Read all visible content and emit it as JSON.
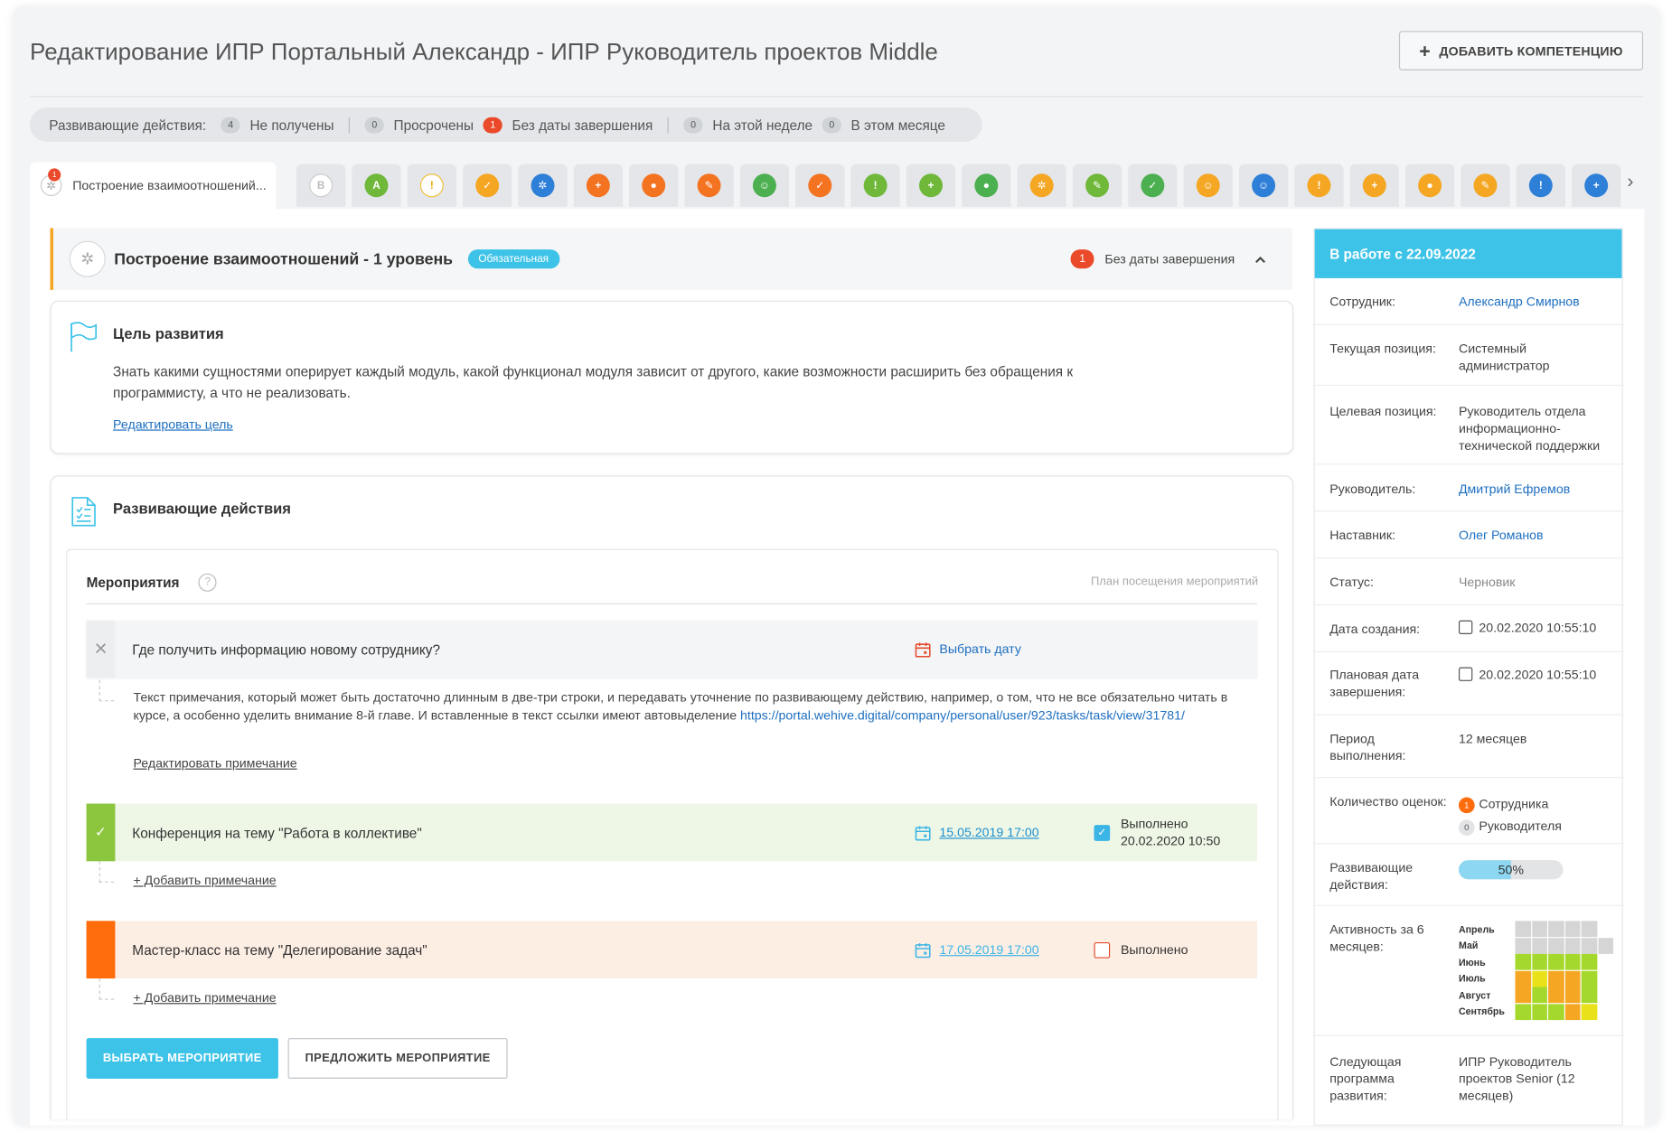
{
  "page": {
    "title": "Редактирование ИПР Портальный Александр - ИПР Руководитель проектов Middle",
    "add_button": "ДОБАВИТЬ КОМПЕТЕНЦИЮ"
  },
  "filters": {
    "label": "Развивающие действия:",
    "items": [
      {
        "count": "4",
        "label": "Не получены",
        "highlight": false
      },
      {
        "count": "0",
        "label": "Просрочены",
        "highlight": false
      },
      {
        "count": "1",
        "label": "Без даты завершения",
        "highlight": true
      },
      {
        "count": "0",
        "label": "На этой неделе",
        "highlight": false
      },
      {
        "count": "0",
        "label": "В этом месяце",
        "highlight": false
      }
    ]
  },
  "tabs": {
    "active": {
      "label": "Построение взаимоотношений...",
      "badge": "1"
    },
    "icons": [
      {
        "name": "b-icon",
        "glyph": "B",
        "color": "#ffffff",
        "fg": "#bbbbbb",
        "border": "#cccccc"
      },
      {
        "name": "a-icon",
        "glyph": "A",
        "color": "#6fb83a",
        "fg": "#ffffff",
        "border": ""
      },
      {
        "name": "medal-icon",
        "glyph": "!",
        "color": "#ffffff",
        "fg": "#f0a500",
        "border": "#f0c040"
      },
      {
        "name": "checkbox-icon",
        "glyph": "✓",
        "color": "#f5a623",
        "fg": "#ffffff",
        "border": ""
      },
      {
        "name": "gear-icon",
        "glyph": "✲",
        "color": "#2d7fd8",
        "fg": "#ffffff",
        "border": ""
      },
      {
        "name": "plus-doc-icon",
        "glyph": "+",
        "color": "#f47321",
        "fg": "#ffffff",
        "border": ""
      },
      {
        "name": "coin-icon",
        "glyph": "●",
        "color": "#f47321",
        "fg": "#ffffff",
        "border": ""
      },
      {
        "name": "pencil-icon",
        "glyph": "✎",
        "color": "#f47321",
        "fg": "#ffffff",
        "border": ""
      },
      {
        "name": "person-icon",
        "glyph": "☺",
        "color": "#4cb050",
        "fg": "#ffffff",
        "border": ""
      },
      {
        "name": "checkbox-icon",
        "glyph": "✓",
        "color": "#f47321",
        "fg": "#ffffff",
        "border": ""
      },
      {
        "name": "medal-icon",
        "glyph": "!",
        "color": "#6fb83a",
        "fg": "#ffffff",
        "border": ""
      },
      {
        "name": "plus-doc-icon",
        "glyph": "+",
        "color": "#6fb83a",
        "fg": "#ffffff",
        "border": ""
      },
      {
        "name": "coin-icon",
        "glyph": "●",
        "color": "#4cb050",
        "fg": "#ffffff",
        "border": ""
      },
      {
        "name": "gear-icon",
        "glyph": "✲",
        "color": "#f5a623",
        "fg": "#ffffff",
        "border": ""
      },
      {
        "name": "pencil-icon",
        "glyph": "✎",
        "color": "#6fb83a",
        "fg": "#ffffff",
        "border": ""
      },
      {
        "name": "checkbox-icon",
        "glyph": "✓",
        "color": "#4cb050",
        "fg": "#ffffff",
        "border": ""
      },
      {
        "name": "person-icon",
        "glyph": "☺",
        "color": "#f5a623",
        "fg": "#ffffff",
        "border": ""
      },
      {
        "name": "person-icon",
        "glyph": "☺",
        "color": "#2d7fd8",
        "fg": "#ffffff",
        "border": ""
      },
      {
        "name": "medal-icon",
        "glyph": "!",
        "color": "#f5a623",
        "fg": "#ffffff",
        "border": ""
      },
      {
        "name": "plus-doc-icon",
        "glyph": "+",
        "color": "#f5a623",
        "fg": "#ffffff",
        "border": ""
      },
      {
        "name": "coin-icon",
        "glyph": "●",
        "color": "#f5a623",
        "fg": "#ffffff",
        "border": ""
      },
      {
        "name": "pencil-icon",
        "glyph": "✎",
        "color": "#f5a623",
        "fg": "#ffffff",
        "border": ""
      },
      {
        "name": "medal-icon",
        "glyph": "!",
        "color": "#2d7fd8",
        "fg": "#ffffff",
        "border": ""
      },
      {
        "name": "plus-doc-icon",
        "glyph": "+",
        "color": "#2d7fd8",
        "fg": "#ffffff",
        "border": ""
      }
    ]
  },
  "competency": {
    "title": "Построение взаимоотношений - 1 уровень",
    "tag": "Обязательная",
    "due_count": "1",
    "due_label": "Без даты завершения"
  },
  "goal": {
    "heading": "Цель развития",
    "text": "Знать какими сущностями оперирует каждый модуль, какой функционал модуля зависит от другого, какие возможности расширить без обращения к программисту, а что не реализовать.",
    "edit_link": "Редактировать цель"
  },
  "actions": {
    "heading": "Развивающие действия",
    "events_heading": "Мероприятия",
    "plan_label": "План посещения мероприятий",
    "rows": [
      {
        "title": "Где получить информацию новому сотруднику?",
        "date_label": "Выбрать дату",
        "note_text": "Текст примечания, который может быть достаточно длинным в две-три строки, и передавать уточнение по развивающему действию, например, о том, что не все обязательно читать в курсе, а особенно уделить внимание 8-й главе. И вставленные в текст ссылки имеют автовыделение ",
        "note_link": "https://portal.wehive.digital/company/personal/user/923/tasks/task/view/31781/",
        "note_edit": "Редактировать примечание"
      },
      {
        "title": "Конференция на тему \"Работа в коллективе\"",
        "date": "15.05.2019  17:00",
        "done_label": "Выполнено",
        "done_date": "20.02.2020 10:50",
        "add_note": "+ Добавить примечание"
      },
      {
        "title": "Мастер-класс на тему \"Делегирование задач\"",
        "date": "17.05.2019  17:00",
        "done_label": "Выполнено",
        "add_note": "+ Добавить примечание"
      }
    ],
    "choose_button": "ВЫБРАТЬ  МЕРОПРИЯТИЕ",
    "suggest_button": "ПРЕДЛОЖИТЬ МЕРОПРИЯТИЕ"
  },
  "sidebar": {
    "header": "В работе с 22.09.2022",
    "employee_label": "Сотрудник:",
    "employee": "Александр Смирнов",
    "current_label": "Текущая позиция:",
    "current": "Системный администратор",
    "target_label": "Целевая позиция:",
    "target": "Руководитель отдела информационно-технической поддержки",
    "manager_label": "Руководитель:",
    "manager": "Дмитрий Ефремов",
    "mentor_label": "Наставник:",
    "mentor": "Олег Романов",
    "status_label": "Статус:",
    "status": "Черновик",
    "created_label": "Дата создания:",
    "created": "20.02.2020 10:55:10",
    "planned_label": "Плановая дата завершения:",
    "planned": "20.02.2020 10:55:10",
    "period_label": "Период выполнения:",
    "period": "12 месяцев",
    "ratings_label": "Количество оценок:",
    "ratings": [
      {
        "count": "1",
        "label": "Сотрудника",
        "active": true
      },
      {
        "count": "0",
        "label": "Руководителя",
        "active": false
      }
    ],
    "dev_label": "Развивающие действия:",
    "dev_progress": 0.5,
    "dev_progress_text": "50%",
    "activity_label": "Активность за 6 месяцев:",
    "activity": [
      {
        "month": "Апрель",
        "cells": [
          "#d5d5d5",
          "#d5d5d5",
          "#d5d5d5",
          "#d5d5d5",
          "#d5d5d5"
        ]
      },
      {
        "month": "Май",
        "cells": [
          "#d5d5d5",
          "#d5d5d5",
          "#d5d5d5",
          "#d5d5d5",
          "#d5d5d5",
          "#d5d5d5"
        ]
      },
      {
        "month": "Июнь",
        "cells": [
          "#a5d82c",
          "#a5d82c",
          "#a5d82c",
          "#a5d82c",
          "#a5d82c"
        ]
      },
      {
        "month": "Июль",
        "cells": [
          "#f5a623",
          "#e9e21a",
          "#f5a623",
          "#f5a623",
          "#a5d82c"
        ]
      },
      {
        "month": "Август",
        "cells": [
          "#f5a623",
          "#a5d82c",
          "#f5a623",
          "#f5a623",
          "#a5d82c"
        ]
      },
      {
        "month": "Сентябрь",
        "cells": [
          "#a5d82c",
          "#a5d82c",
          "#a5d82c",
          "#f5a623",
          "#e9e21a"
        ]
      }
    ],
    "next_label": "Следующая программа развития:",
    "next": "ИПР Руководитель проектов Senior (12 месяцев)"
  }
}
